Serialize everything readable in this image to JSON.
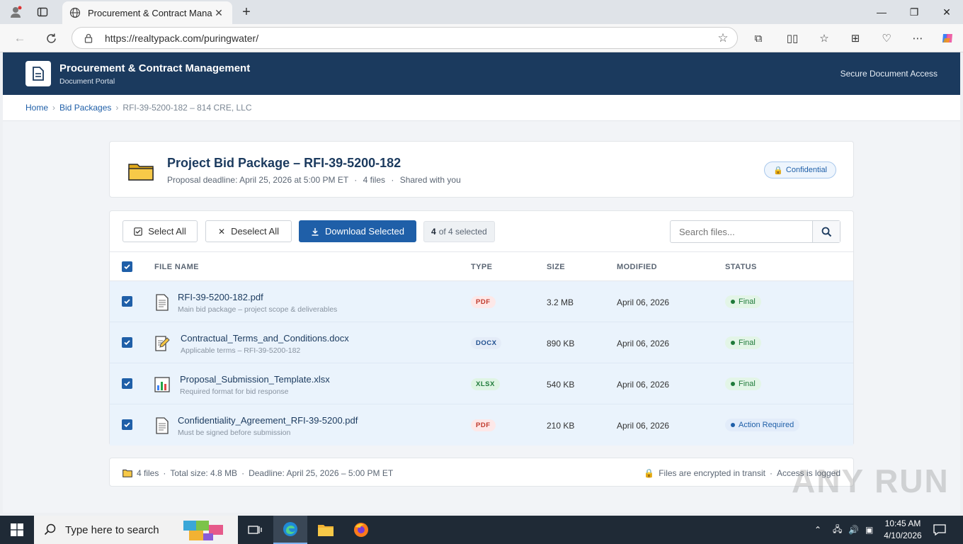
{
  "browser": {
    "tab_title": "Procurement & Contract Management",
    "url": "https://realtypack.com/puringwater/"
  },
  "header": {
    "title": "Procurement & Contract Management",
    "subtitle": "Document Portal",
    "right_text": "Secure Document Access"
  },
  "breadcrumb": [
    "Home",
    "Bid Packages",
    "RFI-39-5200-182 – 814 CRE, LLC"
  ],
  "project": {
    "title": "Project Bid Package – RFI-39-5200-182",
    "deadline": "Proposal deadline: April 25, 2026 at 5:00 PM ET",
    "file_count": "4 files",
    "shared": "Shared with you",
    "badge": "Confidential"
  },
  "toolbar": {
    "select_all": "Select All",
    "deselect_all": "Deselect All",
    "download": "Download Selected",
    "selected_num": "4",
    "selected_rest": "of 4 selected",
    "search_placeholder": "Search files..."
  },
  "columns": [
    "FILE NAME",
    "TYPE",
    "SIZE",
    "MODIFIED",
    "STATUS"
  ],
  "files": [
    {
      "name": "RFI-39-5200-182.pdf",
      "desc": "Main bid package – project scope & deliverables",
      "type": "PDF",
      "size": "3.2 MB",
      "modified": "April 06, 2026",
      "status": "Final",
      "icon": "document-icon"
    },
    {
      "name": "Contractual_Terms_and_Conditions.docx",
      "desc": "Applicable terms – RFI-39-5200-182",
      "type": "DOCX",
      "size": "890 KB",
      "modified": "April 06, 2026",
      "status": "Final",
      "icon": "memo-icon"
    },
    {
      "name": "Proposal_Submission_Template.xlsx",
      "desc": "Required format for bid response",
      "type": "XLSX",
      "size": "540 KB",
      "modified": "April 06, 2026",
      "status": "Final",
      "icon": "chart-icon"
    },
    {
      "name": "Confidentiality_Agreement_RFI-39-5200.pdf",
      "desc": "Must be signed before submission",
      "type": "PDF",
      "size": "210 KB",
      "modified": "April 06, 2026",
      "status": "Action Required",
      "icon": "document-icon"
    }
  ],
  "footer": {
    "files": "4 files",
    "total": "Total size: 4.8 MB",
    "deadline": "Deadline: April 25, 2026 – 5:00 PM ET",
    "encrypted": "Files are encrypted in transit",
    "logged": "Access is logged"
  },
  "taskbar": {
    "search_placeholder": "Type here to search",
    "time": "10:45 AM",
    "date": "4/10/2026"
  },
  "watermark": "ANY RUN"
}
